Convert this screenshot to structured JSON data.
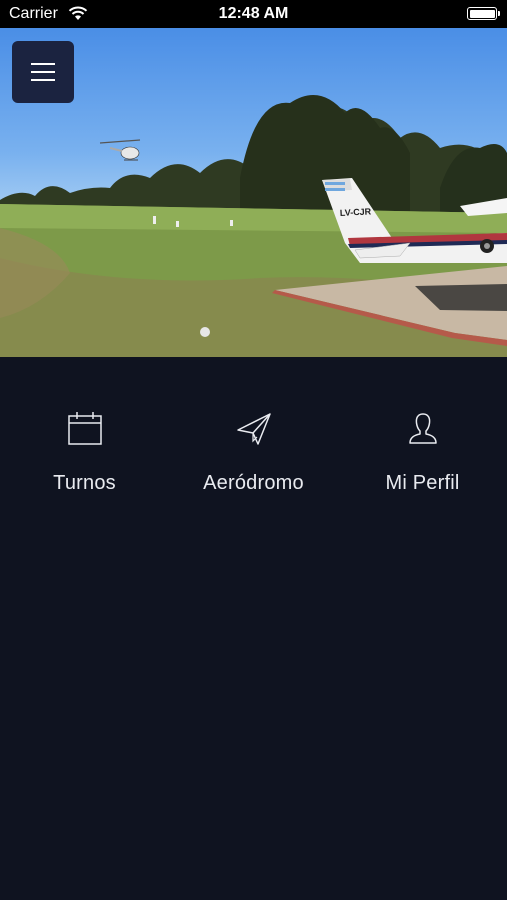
{
  "status_bar": {
    "carrier": "Carrier",
    "time": "12:48 AM"
  },
  "hero": {
    "aircraft_registration": "LV-CJR",
    "carousel_pages": 1,
    "current_page": 1
  },
  "menu_button": {
    "icon": "hamburger-icon"
  },
  "nav": [
    {
      "label": "Turnos",
      "icon": "calendar-icon"
    },
    {
      "label": "Aeródromo",
      "icon": "paper-plane-icon"
    },
    {
      "label": "Mi Perfil",
      "icon": "user-icon"
    }
  ],
  "colors": {
    "background": "#0f1320",
    "menu_button": "#1b2340",
    "text": "#e9ebf0"
  }
}
